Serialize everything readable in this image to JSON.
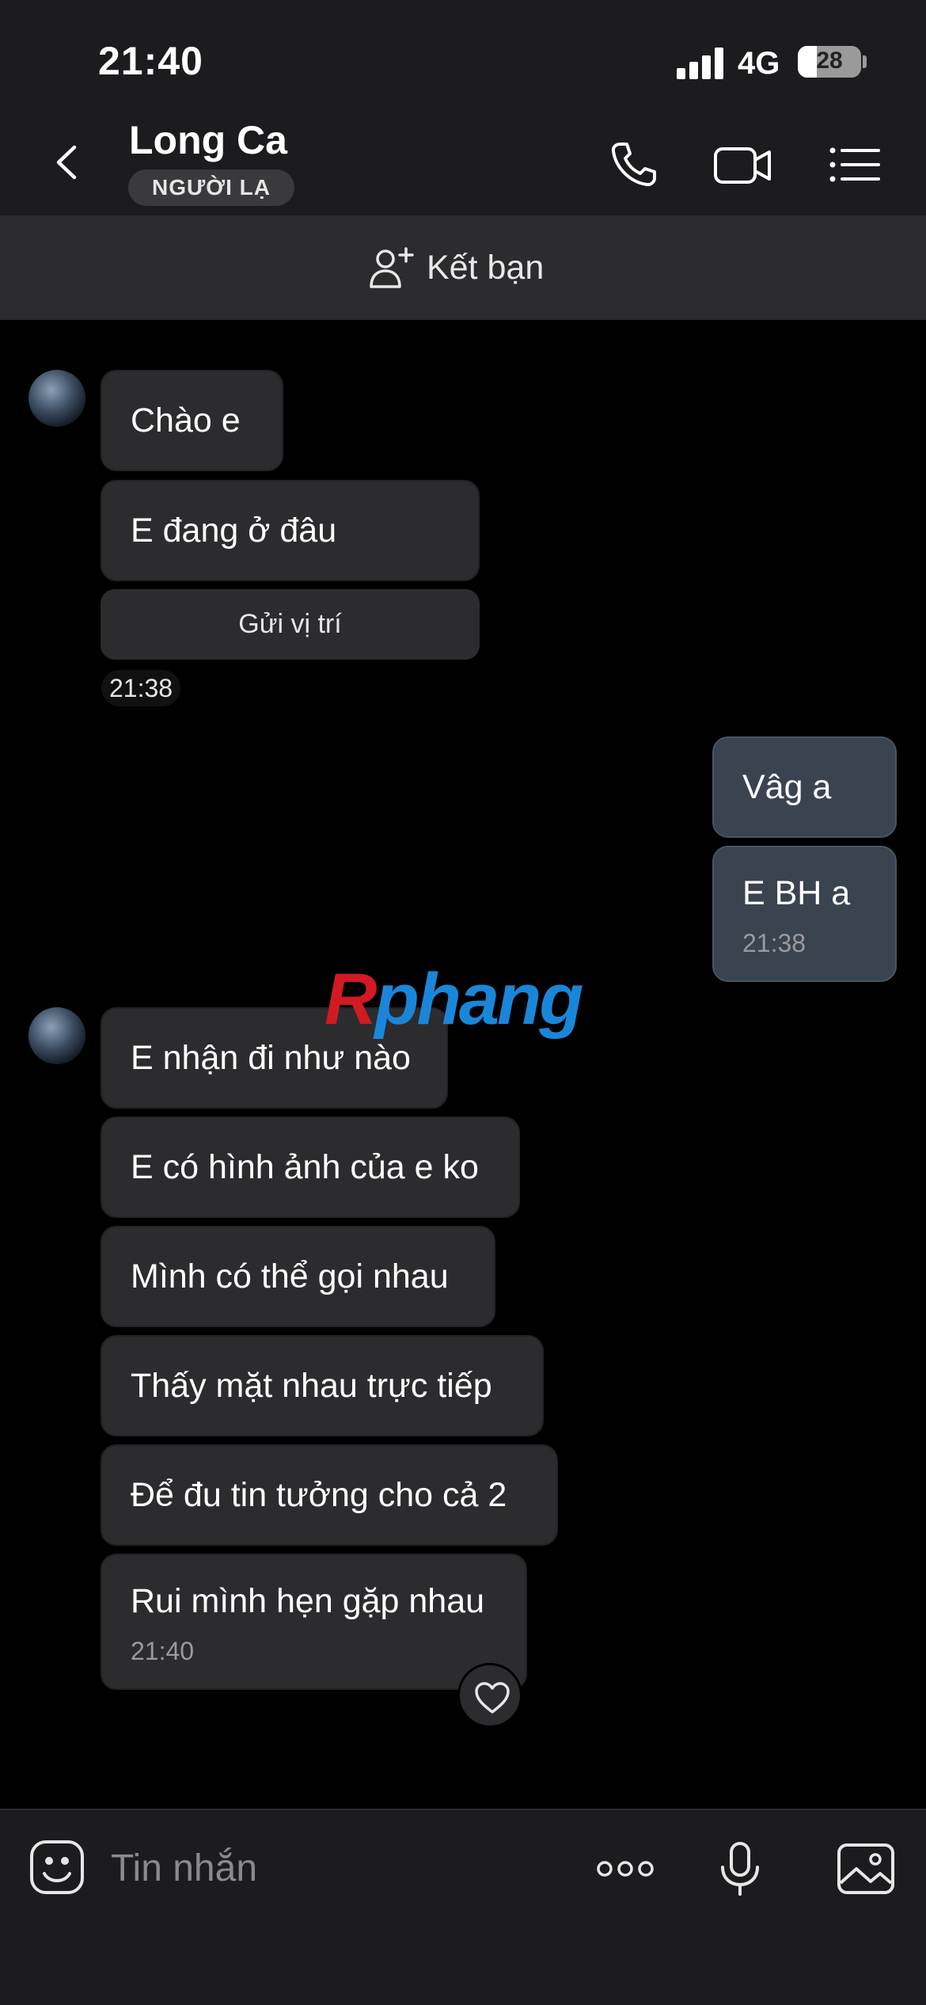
{
  "status_bar": {
    "time": "21:40",
    "network": "4G",
    "battery": "28"
  },
  "header": {
    "contact_name": "Long Ca",
    "badge": "NGƯỜI LẠ"
  },
  "add_friend": {
    "label": "Kết bạn"
  },
  "messages": {
    "in1": "Chào e",
    "in2": "E đang ở đâu",
    "location_button": "Gửi vị trí",
    "time1": "21:38",
    "out1": "Vâg a",
    "out2": "E BH a",
    "out2_time": "21:38",
    "in3": "E nhận đi như nào",
    "in4": "E có hình ảnh của e ko",
    "in5": "Mình có thể gọi nhau",
    "in6": "Thấy mặt nhau trực tiếp",
    "in7": "Để đu tin tưởng cho cả 2",
    "in8": "Rui mình hẹn gặp nhau",
    "in8_time": "21:40"
  },
  "watermark": {
    "part1": "R",
    "part2": "phang"
  },
  "composer": {
    "placeholder": "Tin nhắn"
  },
  "colors": {
    "background": "#000000",
    "bar": "#1c1c1e",
    "bubble_in": "#2c2c2e",
    "bubble_out": "#3a4350"
  },
  "icons": [
    "back-icon",
    "phone-icon",
    "video-call-icon",
    "menu-list-icon",
    "add-person-icon",
    "heart-icon",
    "emoji-icon",
    "more-icon",
    "microphone-icon",
    "image-icon"
  ]
}
